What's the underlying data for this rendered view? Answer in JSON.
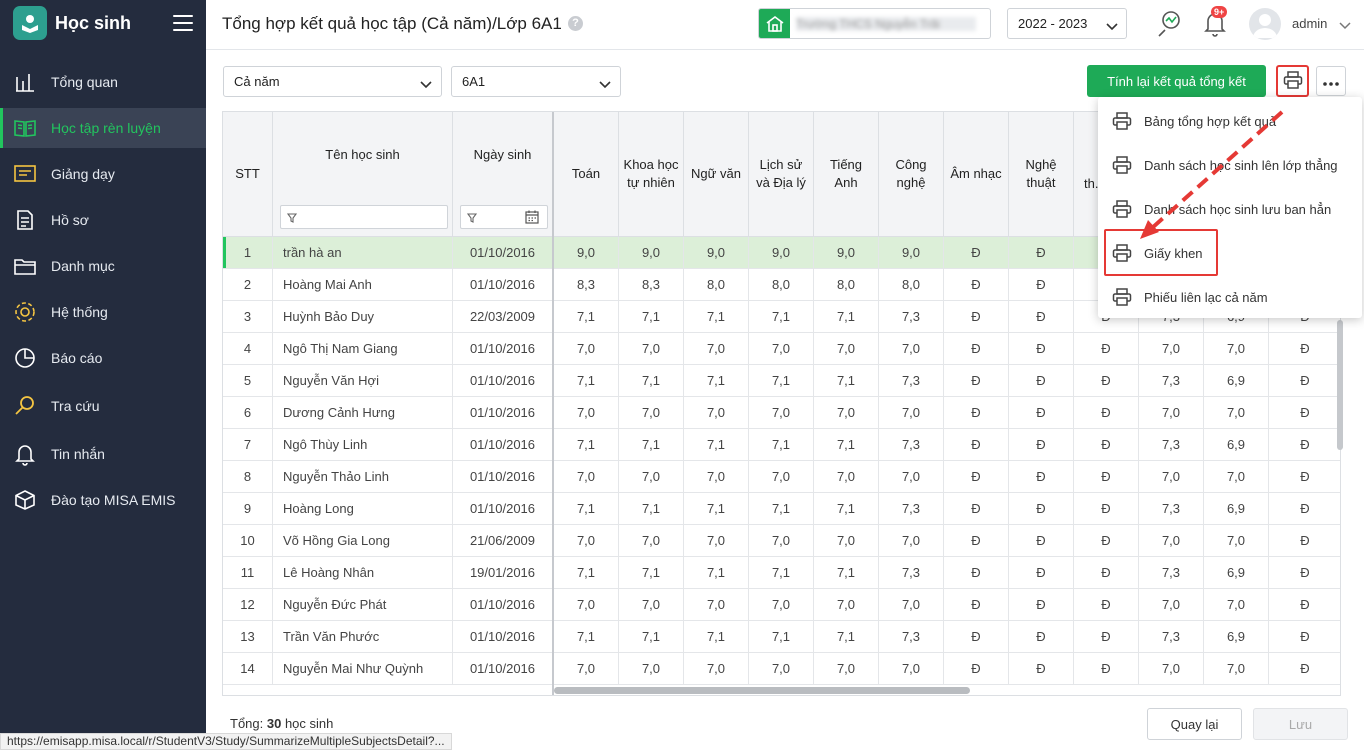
{
  "sidebar": {
    "brand": "Học sinh",
    "items": [
      {
        "label": "Tổng quan",
        "icon": "bar-chart-icon",
        "active": false
      },
      {
        "label": "Học tập rèn luyện",
        "icon": "open-book-icon",
        "active": true
      },
      {
        "label": "Giảng dạy",
        "icon": "chalkboard-icon",
        "active": false
      },
      {
        "label": "Hồ sơ",
        "icon": "document-icon",
        "active": false
      },
      {
        "label": "Danh mục",
        "icon": "folder-icon",
        "active": false
      },
      {
        "label": "Hệ thống",
        "icon": "gear-icon",
        "active": false
      },
      {
        "label": "Báo cáo",
        "icon": "pie-chart-icon",
        "active": false
      },
      {
        "label": "Tra cứu",
        "icon": "search-icon",
        "active": false
      },
      {
        "label": "Tin nhắn",
        "icon": "bell-icon",
        "active": false
      },
      {
        "label": "Đào tạo MISA EMIS",
        "icon": "cube-icon",
        "active": false
      }
    ]
  },
  "header": {
    "title": "Tổng hợp kết quả học tập (Cả năm)/Lớp 6A1",
    "help": "?",
    "school_name": "Trường THCS Nguyễn Trãi",
    "year": "2022 - 2023",
    "notification_badge": "9+",
    "user": "admin"
  },
  "toolbar": {
    "period": "Cả năm",
    "class": "6A1",
    "recalc_label": "Tính lại kết quả tổng kết"
  },
  "table": {
    "headers": {
      "stt": "STT",
      "name": "Tên học sinh",
      "dob": "Ngày sinh",
      "subjects": [
        "Toán",
        "Khoa học tự nhiên",
        "Ngữ văn",
        "Lịch sử và Địa lý",
        "Tiếng Anh",
        "Công nghệ",
        "Âm nhạc",
        "Nghệ thuật",
        "th..."
      ]
    },
    "rows": [
      {
        "stt": "1",
        "name": "trần hà an",
        "dob": "01/10/2016",
        "scores": [
          "9,0",
          "9,0",
          "9,0",
          "9,0",
          "9,0",
          "9,0",
          "Đ",
          "Đ",
          "Đ",
          "9,0",
          "9,0",
          "Đ"
        ]
      },
      {
        "stt": "2",
        "name": "Hoàng Mai Anh",
        "dob": "01/10/2016",
        "scores": [
          "8,3",
          "8,3",
          "8,0",
          "8,0",
          "8,0",
          "8,0",
          "Đ",
          "Đ",
          "Đ",
          "8,0",
          "8,0",
          "Đ"
        ]
      },
      {
        "stt": "3",
        "name": "Huỳnh Bảo Duy",
        "dob": "22/03/2009",
        "scores": [
          "7,1",
          "7,1",
          "7,1",
          "7,1",
          "7,1",
          "7,3",
          "Đ",
          "Đ",
          "Đ",
          "7,3",
          "6,9",
          "Đ"
        ]
      },
      {
        "stt": "4",
        "name": "Ngô Thị Nam Giang",
        "dob": "01/10/2016",
        "scores": [
          "7,0",
          "7,0",
          "7,0",
          "7,0",
          "7,0",
          "7,0",
          "Đ",
          "Đ",
          "Đ",
          "7,0",
          "7,0",
          "Đ"
        ]
      },
      {
        "stt": "5",
        "name": "Nguyễn Văn Hợi",
        "dob": "01/10/2016",
        "scores": [
          "7,1",
          "7,1",
          "7,1",
          "7,1",
          "7,1",
          "7,3",
          "Đ",
          "Đ",
          "Đ",
          "7,3",
          "6,9",
          "Đ"
        ]
      },
      {
        "stt": "6",
        "name": "Dương Cảnh Hưng",
        "dob": "01/10/2016",
        "scores": [
          "7,0",
          "7,0",
          "7,0",
          "7,0",
          "7,0",
          "7,0",
          "Đ",
          "Đ",
          "Đ",
          "7,0",
          "7,0",
          "Đ"
        ]
      },
      {
        "stt": "7",
        "name": "Ngô Thùy Linh",
        "dob": "01/10/2016",
        "scores": [
          "7,1",
          "7,1",
          "7,1",
          "7,1",
          "7,1",
          "7,3",
          "Đ",
          "Đ",
          "Đ",
          "7,3",
          "6,9",
          "Đ"
        ]
      },
      {
        "stt": "8",
        "name": "Nguyễn Thảo Linh",
        "dob": "01/10/2016",
        "scores": [
          "7,0",
          "7,0",
          "7,0",
          "7,0",
          "7,0",
          "7,0",
          "Đ",
          "Đ",
          "Đ",
          "7,0",
          "7,0",
          "Đ"
        ]
      },
      {
        "stt": "9",
        "name": "Hoàng Long",
        "dob": "01/10/2016",
        "scores": [
          "7,1",
          "7,1",
          "7,1",
          "7,1",
          "7,1",
          "7,3",
          "Đ",
          "Đ",
          "Đ",
          "7,3",
          "6,9",
          "Đ"
        ]
      },
      {
        "stt": "10",
        "name": "Võ Hồng Gia Long",
        "dob": "21/06/2009",
        "scores": [
          "7,0",
          "7,0",
          "7,0",
          "7,0",
          "7,0",
          "7,0",
          "Đ",
          "Đ",
          "Đ",
          "7,0",
          "7,0",
          "Đ"
        ]
      },
      {
        "stt": "11",
        "name": "Lê Hoàng Nhân",
        "dob": "19/01/2016",
        "scores": [
          "7,1",
          "7,1",
          "7,1",
          "7,1",
          "7,1",
          "7,3",
          "Đ",
          "Đ",
          "Đ",
          "7,3",
          "6,9",
          "Đ"
        ]
      },
      {
        "stt": "12",
        "name": "Nguyễn Đức Phát",
        "dob": "01/10/2016",
        "scores": [
          "7,0",
          "7,0",
          "7,0",
          "7,0",
          "7,0",
          "7,0",
          "Đ",
          "Đ",
          "Đ",
          "7,0",
          "7,0",
          "Đ"
        ]
      },
      {
        "stt": "13",
        "name": "Trần Văn Phước",
        "dob": "01/10/2016",
        "scores": [
          "7,1",
          "7,1",
          "7,1",
          "7,1",
          "7,1",
          "7,3",
          "Đ",
          "Đ",
          "Đ",
          "7,3",
          "6,9",
          "Đ"
        ]
      },
      {
        "stt": "14",
        "name": "Nguyễn Mai Như Quỳnh",
        "dob": "01/10/2016",
        "scores": [
          "7,0",
          "7,0",
          "7,0",
          "7,0",
          "7,0",
          "7,0",
          "Đ",
          "Đ",
          "Đ",
          "7,0",
          "7,0",
          "Đ"
        ]
      }
    ]
  },
  "print_menu": {
    "items": [
      "Bảng tổng hợp kết quả",
      "Danh sách học sinh lên lớp thẳng",
      "Danh sách học sinh lưu ban hẳn",
      "Giấy khen",
      "Phiếu liên lạc cả năm"
    ]
  },
  "footer": {
    "total_prefix": "Tổng: ",
    "total_count": "30",
    "total_suffix": " học sinh",
    "back_label": "Quay lại",
    "save_label": "Lưu"
  },
  "status_url": "https://emisapp.misa.local/r/StudentV3/Study/SummarizeMultipleSubjectsDetail?...",
  "colors": {
    "accent": "#1eaa57",
    "sidebar_bg": "#242c3e",
    "highlight": "#e53935",
    "selected_row": "#dcefd8"
  }
}
